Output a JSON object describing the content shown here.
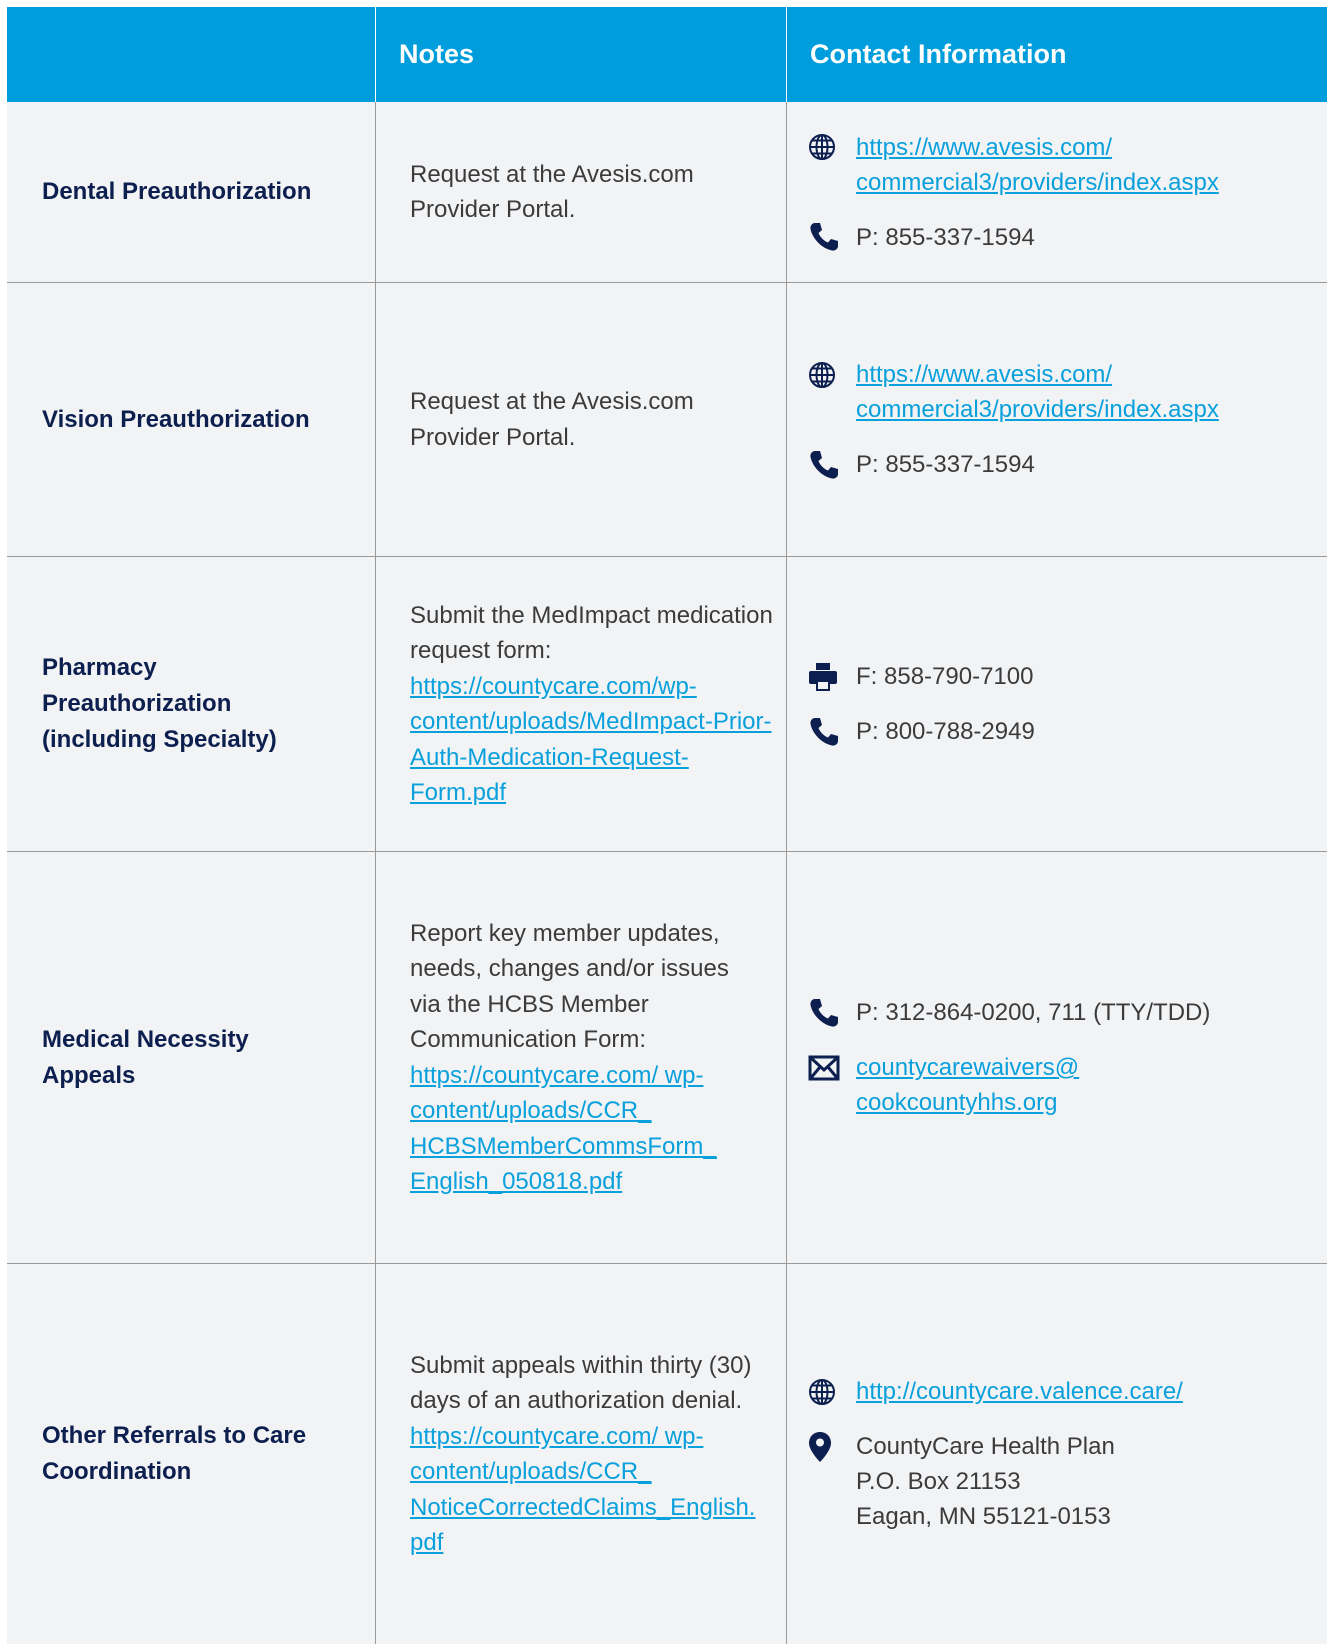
{
  "header": {
    "notes": "Notes",
    "contact": "Contact Information"
  },
  "rows": [
    {
      "label": "Dental Preauthorization",
      "note_text": "Request at the Avesis.com Provider Portal.",
      "contacts": [
        {
          "icon": "globe-icon",
          "text": "https://www.avesis.com/ commercial3/providers/index.aspx",
          "link": true
        },
        {
          "icon": "phone-icon",
          "text": "P: 855-337-1594",
          "link": false
        }
      ]
    },
    {
      "label": "Vision Preauthorization",
      "note_text": "Request at the Avesis.com Provider Portal.",
      "contacts": [
        {
          "icon": "globe-icon",
          "text": "https://www.avesis.com/ commercial3/providers/index.aspx",
          "link": true
        },
        {
          "icon": "phone-icon",
          "text": "P: 855-337-1594",
          "link": false
        }
      ]
    },
    {
      "label": "Pharmacy Preauthorization (including Specialty)",
      "note_text": "Submit the MedImpact medication request form:",
      "note_link": "https://countycare.com/wp-content/uploads/MedImpact-Prior-Auth-Medication-Request-Form.pdf",
      "contacts": [
        {
          "icon": "fax-icon",
          "text": "F: 858-790-7100",
          "link": false
        },
        {
          "icon": "phone-icon",
          "text": "P: 800-788-2949",
          "link": false
        }
      ]
    },
    {
      "label": "Medical Necessity Appeals",
      "note_text": "Report key member updates, needs, changes and/or issues via the HCBS Member Communication Form:",
      "note_link": "https://countycare.com/ wp-content/uploads/CCR_ HCBSMemberCommsForm_ English_050818.pdf",
      "contacts": [
        {
          "icon": "phone-icon",
          "text": "P: 312-864-0200, 711 (TTY/TDD)",
          "link": false
        },
        {
          "icon": "mail-icon",
          "text": "countycarewaivers@ cookcountyhhs.org",
          "link": true
        }
      ]
    },
    {
      "label": "Other Referrals to Care Coordination",
      "note_text": "Submit appeals within thirty (30) days of an authorization denial.",
      "note_link": "https://countycare.com/ wp-content/uploads/CCR_ NoticeCorrectedClaims_English. pdf",
      "contacts": [
        {
          "icon": "globe-icon",
          "text": "http://countycare.valence.care/",
          "link": true
        },
        {
          "icon": "location-pin-icon",
          "text": "CountyCare Health Plan",
          "line2": "P.O. Box 21153",
          "line3": "Eagan, MN 55121-0153",
          "link": false
        }
      ]
    }
  ],
  "colors": {
    "header_bg": "#009ddc",
    "row_bg": "#f2f3f5",
    "label": "#0d1f4f",
    "link": "#0aa0dc",
    "icon": "#0d1f4f"
  }
}
